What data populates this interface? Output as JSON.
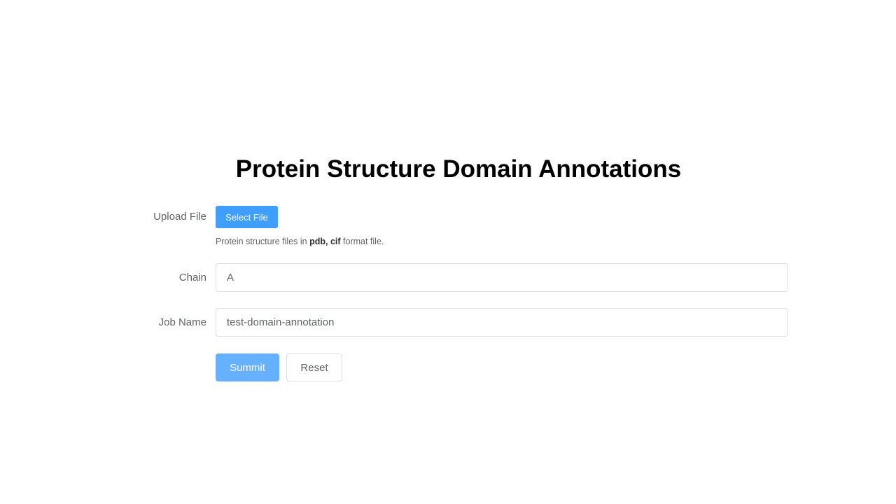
{
  "page": {
    "title": "Protein Structure Domain Annotations"
  },
  "form": {
    "upload": {
      "label": "Upload File",
      "button_label": "Select File",
      "hint_prefix": "Protein structure files in ",
      "hint_formats": "pdb, cif",
      "hint_suffix": " format file."
    },
    "chain": {
      "label": "Chain",
      "value": "A"
    },
    "job_name": {
      "label": "Job Name",
      "value": "test-domain-annotation"
    },
    "actions": {
      "submit_label": "Summit",
      "reset_label": "Reset"
    }
  },
  "colors": {
    "primary": "#409eff",
    "primary_light": "#66b1ff",
    "border": "#dcdfe6",
    "label_text": "#606266"
  }
}
